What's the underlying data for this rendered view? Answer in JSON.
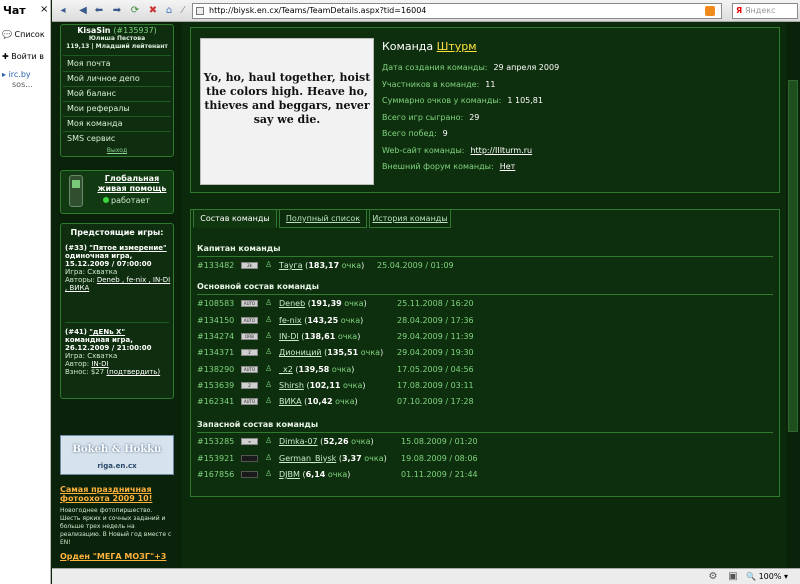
{
  "chat": {
    "title": "Чат",
    "close": "×",
    "list_label": "Список",
    "login_label": "Войти в",
    "irc_label": "irc.by",
    "sos_label": "sos..."
  },
  "browser": {
    "url": "http://biysk.en.cx/Teams/TeamDetails.aspx?tid=16004",
    "search_placeholder": "Яндекс",
    "search_logo": "Я",
    "zoom": "100%"
  },
  "sidebar": {
    "username": "KisaSin",
    "user_id": "(#135937)",
    "rank_line1": "Юлиша Пестова",
    "rank_line2": "119,13 | Младший лейтенант",
    "menu": [
      "Моя почта",
      "Мой личное депо",
      "Мой баланс",
      "Мои рефералы",
      "Моя команда",
      "SMS сервис"
    ],
    "logout": "Выход",
    "help_link": "Глобальная живая помощь",
    "help_status": "работает",
    "upcoming_title": "Предстоящие игры:",
    "games": [
      {
        "num": "(#33)",
        "name": "\"Пятое измерение\"",
        "kind_date": "одиночная игра, 15.12.2009 / 07:00:00",
        "game_label": "Игра:",
        "game": "Схватка",
        "authors_label": "Авторы:",
        "authors": "Deneb , fe-nix , IN-DI , ВИКА"
      },
      {
        "num": "(#41)",
        "name": "\"дЕNь X\"",
        "kind_date": "командная игра, 26.12.2009 / 21:00:00",
        "game_label": "Игра:",
        "game": "Схватка",
        "authors_label": "Автор:",
        "authors": "IN-DI",
        "fee_label": "Взнос:",
        "fee": "$27",
        "fee_link": "(подтвердить)"
      }
    ],
    "banner_title": "Bokeh & Hokku",
    "banner_sub": "riga.en.cx",
    "news1_title": "Самая праздничная фотоохота 2009 10!",
    "news1_body": "Новогоднее фотопиршество. Шесть ярких и сочных заданий и больше трех недель на реализацию. В Новый год вместе с EN!",
    "news2_title": "Орден \"МЕГА МОЗГ\"+3"
  },
  "team": {
    "label": "Команда",
    "name": "Штурм",
    "logo_text": "Yo, ho, haul together, hoist the colors high. Heave ho, thieves and beggars, never say we die.",
    "info": [
      {
        "label": "Дата создания команды:",
        "value": "29 апреля 2009"
      },
      {
        "label": "Участников в команде:",
        "value": "11"
      },
      {
        "label": "Суммарно очков у команды:",
        "value": "1 105,81"
      },
      {
        "label": "Всего игр сыграно:",
        "value": "29"
      },
      {
        "label": "Всего побед:",
        "value": "9"
      },
      {
        "label": "Web-сайт команды:",
        "value": "http://IIIturm.ru",
        "link": true
      },
      {
        "label": "Внешний форум команды:",
        "value": "Нет",
        "link": true
      }
    ]
  },
  "tabs": [
    "Состав команды",
    "Полупный список",
    "История команды"
  ],
  "roster": {
    "captain_title": "Капитан команды",
    "main_title": "Основной состав команды",
    "reserve_title": "Запасной состав команды",
    "points_word": "очка",
    "captain": [
      {
        "id": "#133482",
        "badge": "2k",
        "name": "Тауга",
        "points": "183,17",
        "date": "25.04.2009 / 01:09"
      }
    ],
    "main": [
      {
        "id": "#108583",
        "badge": "AUTO",
        "name": "Deneb",
        "points": "191,39",
        "date": "25.11.2008 / 16:20"
      },
      {
        "id": "#134150",
        "badge": "AUTO",
        "name": "fe-nix",
        "points": "143,25",
        "date": "28.04.2009 / 17:36"
      },
      {
        "id": "#134274",
        "badge": "ORB",
        "name": "IN-DI",
        "points": "138,61",
        "date": "29.04.2009 / 11:39"
      },
      {
        "id": "#134371",
        "badge": "2",
        "name": "Диониций",
        "points": "135,51",
        "date": "29.04.2009 / 19:30"
      },
      {
        "id": "#138290",
        "badge": "AUTO",
        "name": "_x2",
        "points": "139,58",
        "date": "17.05.2009 / 04:56"
      },
      {
        "id": "#153639",
        "badge": "2",
        "name": "Shirsh",
        "points": "102,11",
        "date": "17.08.2009 / 03:11"
      },
      {
        "id": "#162341",
        "badge": "AUTO",
        "name": "ВИКА",
        "points": "10,42",
        "date": "07.10.2009 / 17:28"
      }
    ],
    "reserve": [
      {
        "id": "#153285",
        "badge": "∞",
        "name": "Dimka-07",
        "points": "52,26",
        "date": "15.08.2009 / 01:20"
      },
      {
        "id": "#153921",
        "badge": "",
        "name": "German_Biysk",
        "points": "3,37",
        "date": "19.08.2009 / 08:06",
        "dark": true
      },
      {
        "id": "#167856",
        "badge": "",
        "name": "DJBM",
        "points": "6,14",
        "date": "01.11.2009 / 21:44",
        "dark": true
      }
    ]
  }
}
